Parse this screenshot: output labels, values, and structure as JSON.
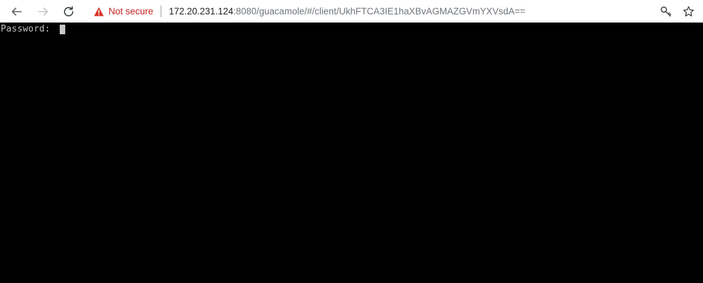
{
  "browser": {
    "security_label": "Not secure",
    "url_host": "172.20.231.124",
    "url_rest": ":8080/guacamole/#/client/UkhFTCA3IE1haXBvAGMAZGVmYXVsdA==",
    "icons": {
      "back": "back-arrow-icon",
      "forward": "forward-arrow-icon",
      "reload": "reload-icon",
      "warning": "warning-triangle-icon",
      "key": "key-icon",
      "star": "star-icon"
    },
    "colors": {
      "security_red": "#c5221f",
      "url_host": "#202124",
      "url_path": "#70757a"
    }
  },
  "terminal": {
    "prompt": "Password: ",
    "background": "#000000",
    "foreground": "#bfbfbf"
  }
}
